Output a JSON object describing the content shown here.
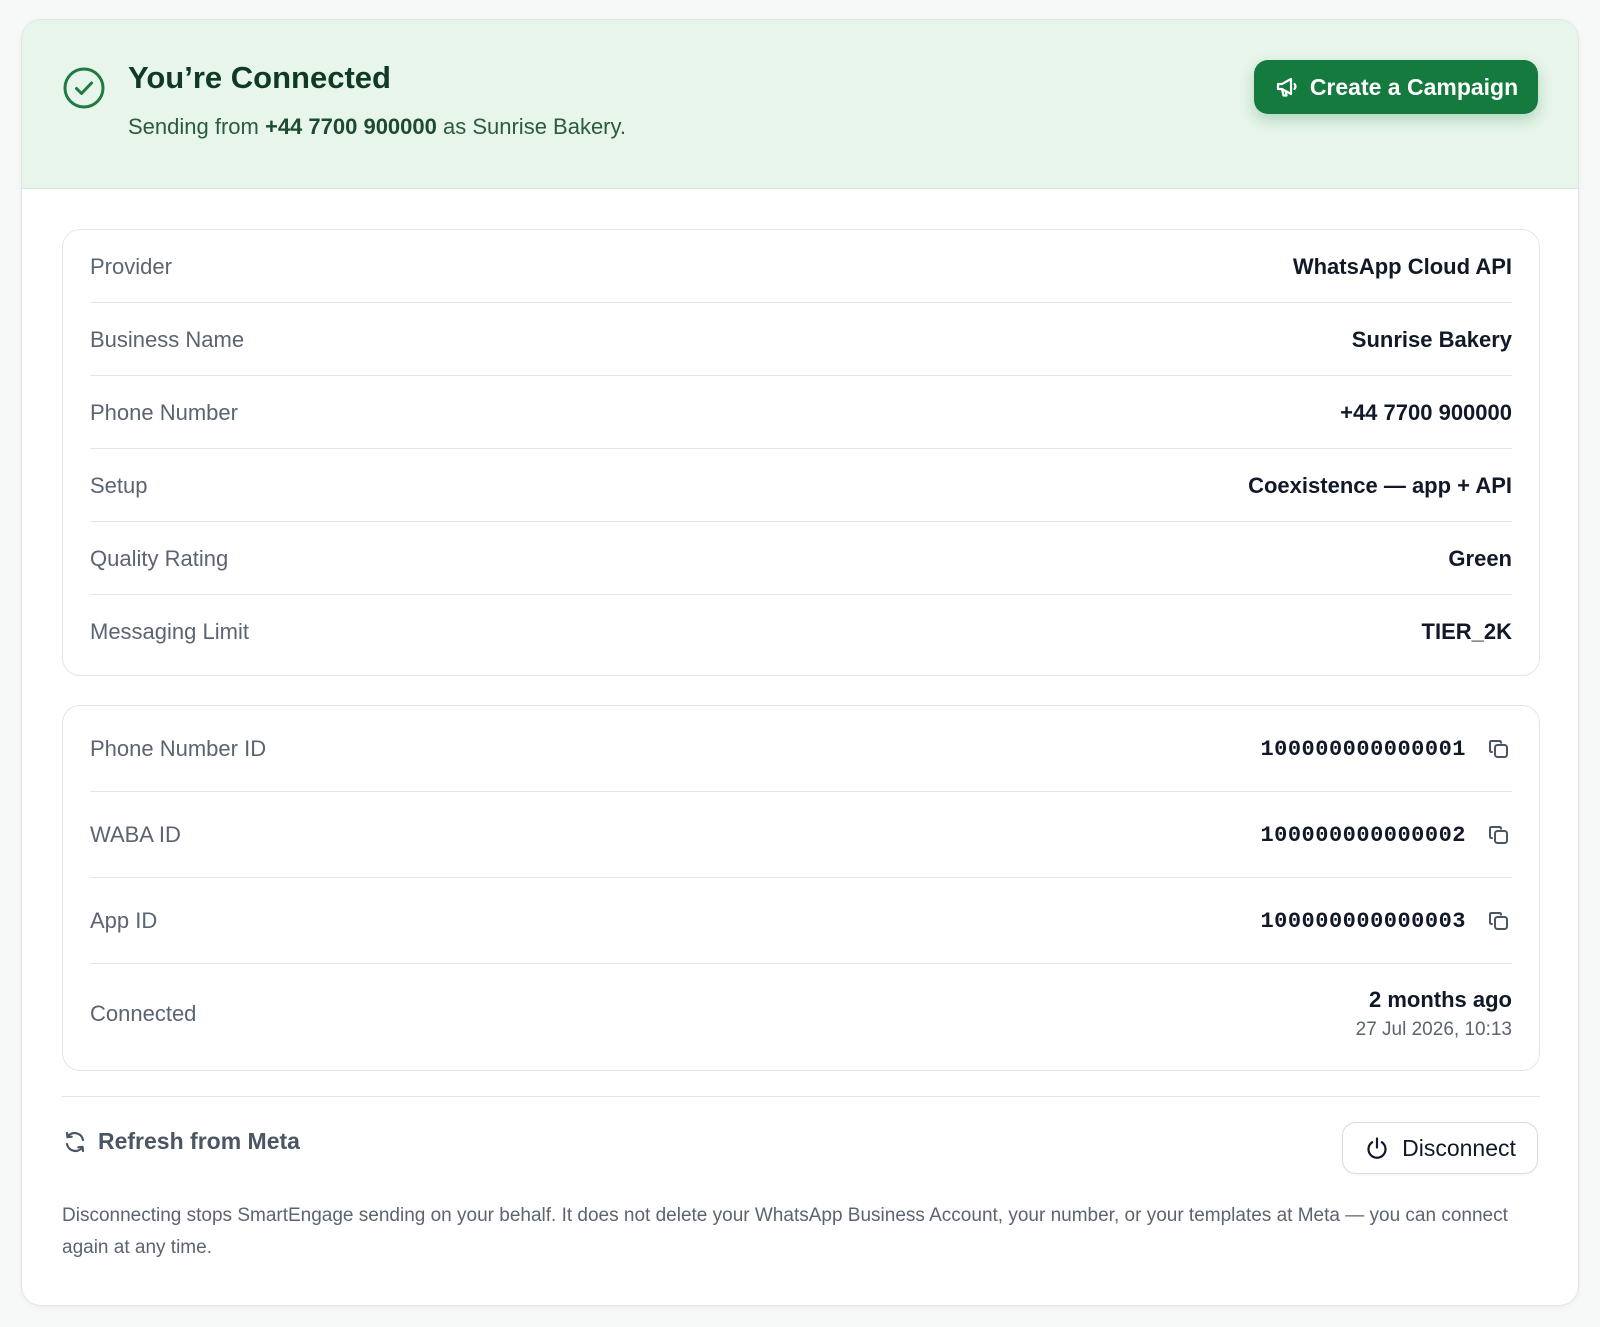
{
  "banner": {
    "title": "You’re Connected",
    "sub_prefix": "Sending from ",
    "sub_phone": "+44 7700 900000",
    "sub_suffix": " as Sunrise Bakery.",
    "cta_label": "Create a Campaign",
    "accent": "#157a3e",
    "bg": "#e7f5ea"
  },
  "details": [
    {
      "label": "Provider",
      "value": "WhatsApp Cloud API"
    },
    {
      "label": "Business Name",
      "value": "Sunrise Bakery"
    },
    {
      "label": "Phone Number",
      "value": "+44 7700 900000"
    },
    {
      "label": "Setup",
      "value": "Coexistence — app + API"
    },
    {
      "label": "Quality Rating",
      "value": "Green"
    },
    {
      "label": "Messaging Limit",
      "value": "TIER_2K"
    }
  ],
  "ids": [
    {
      "label": "Phone Number ID",
      "value": "100000000000001"
    },
    {
      "label": "WABA ID",
      "value": "100000000000002"
    },
    {
      "label": "App ID",
      "value": "100000000000003"
    }
  ],
  "connected": {
    "label": "Connected",
    "relative": "2 months ago",
    "timestamp": "27 Jul 2026, 10:13"
  },
  "footer": {
    "refresh_label": "Refresh from Meta",
    "disconnect_label": "Disconnect",
    "note": "Disconnecting stops SmartEngage sending on your behalf. It does not delete your WhatsApp Business Account, your number, or your templates at Meta — you can connect again at any time."
  },
  "icons": {
    "status": "check-circle-icon",
    "cta": "megaphone-icon",
    "copy": "copy-icon",
    "refresh": "refresh-icon",
    "disconnect": "power-icon"
  }
}
